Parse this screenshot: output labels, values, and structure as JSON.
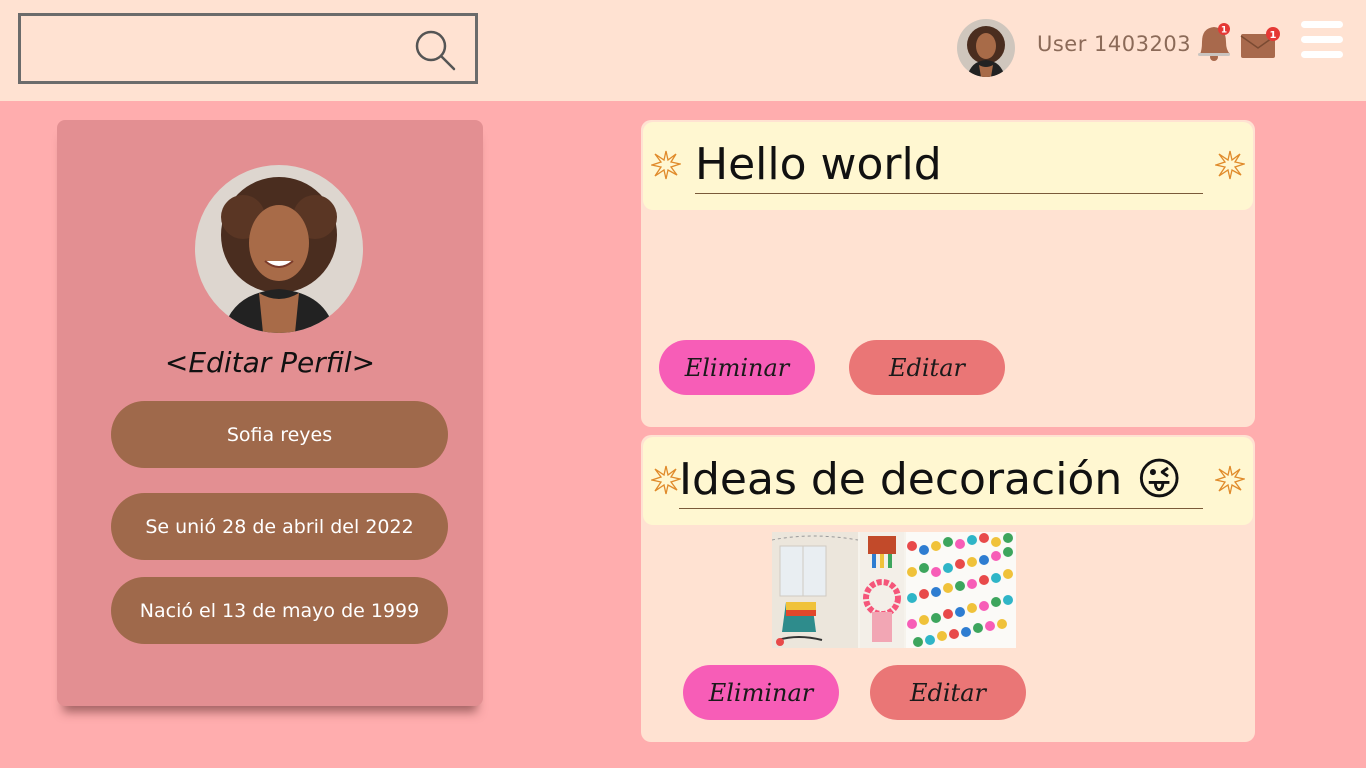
{
  "header": {
    "search": {
      "placeholder": "",
      "icon": "search-icon"
    },
    "username": "User 1403203",
    "notifications": {
      "icon": "bell-icon",
      "count": "1"
    },
    "messages": {
      "icon": "mail-icon",
      "count": "1"
    },
    "menu_icon": "hamburger-menu-icon"
  },
  "profile": {
    "edit_link": "<Editar Perfil>",
    "name": "Sofia reyes",
    "joined": "Se unió 28 de abril del 2022",
    "born": "Nació el 13 de mayo de 1999"
  },
  "posts": [
    {
      "title": "Hello world",
      "delete_label": "Eliminar",
      "edit_label": "Editar"
    },
    {
      "title": "Ideas de decoración 😜",
      "delete_label": "Eliminar",
      "edit_label": "Editar"
    }
  ],
  "colors": {
    "page_bg": "#ffadae",
    "header_bg": "#ffe2d2",
    "profile_card": "#e38f92",
    "pill": "#9f694b",
    "post_bg": "#ffe2d2",
    "post_header": "#fff7d1",
    "delete_button": "#f75db7",
    "edit_button": "#ea7676",
    "badge": "#e53935"
  }
}
